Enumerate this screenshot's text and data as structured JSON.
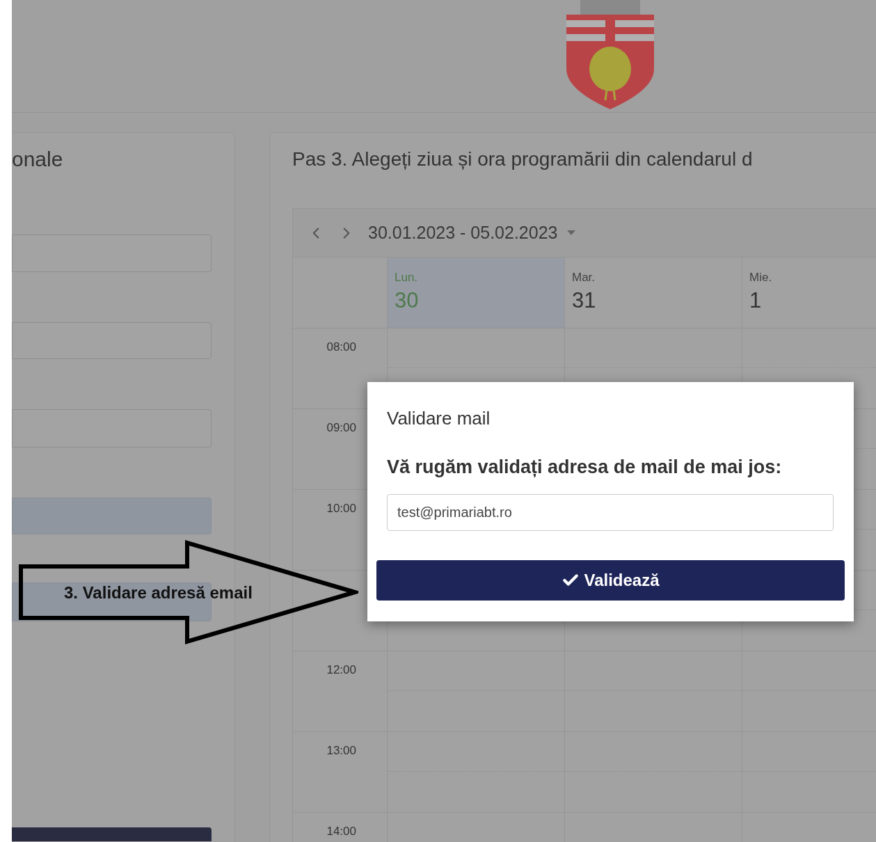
{
  "left_panel": {
    "title": "onale"
  },
  "right_panel": {
    "title": "Pas 3. Alegeți ziua și ora programării din calendarul d"
  },
  "calendar": {
    "range": "30.01.2023 - 05.02.2023",
    "days": [
      {
        "name": "Lun.",
        "date": "30",
        "selected": true
      },
      {
        "name": "Mar.",
        "date": "31",
        "selected": false
      },
      {
        "name": "Mie.",
        "date": "1",
        "selected": false
      }
    ],
    "hours_above_arrow": [
      {
        "label": "08:00"
      },
      {
        "label": "09:00"
      },
      {
        "label": "10:00"
      }
    ],
    "hours_below_arrow": [
      {
        "label": "12:00"
      },
      {
        "label": "13:00"
      },
      {
        "label": "14:00"
      }
    ]
  },
  "dialog": {
    "title": "Validare mail",
    "message": "Vă rugăm validați adresa de mail de mai jos:",
    "email": "test@primariabt.ro",
    "button": "Validează"
  },
  "annotation": {
    "label": "3. Validare adresă email"
  }
}
